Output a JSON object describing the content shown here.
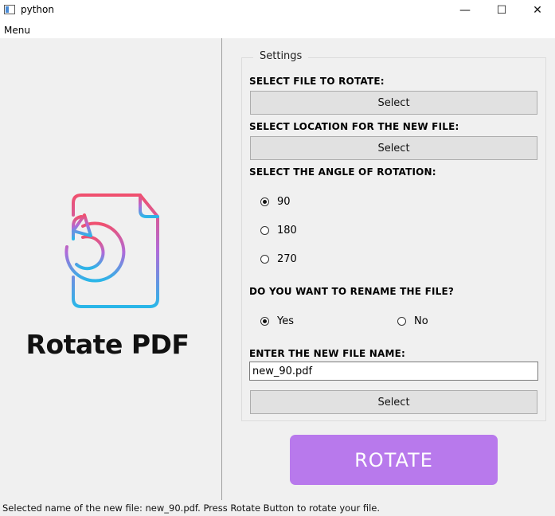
{
  "window": {
    "title": "python",
    "minimize_glyph": "—",
    "maximize_glyph": "☐",
    "close_glyph": "✕"
  },
  "menubar": {
    "menu_label": "Menu"
  },
  "logo": {
    "title": "Rotate PDF",
    "gradient_colors": [
      "#f0506e",
      "#b06ad9",
      "#2ab6e8"
    ]
  },
  "settings": {
    "group_title": "Settings",
    "select_file_label": "SELECT FILE TO ROTATE:",
    "select_file_button": "Select",
    "select_location_label": "SELECT LOCATION FOR THE NEW FILE:",
    "select_location_button": "Select",
    "angle_label": "SELECT THE ANGLE OF ROTATION:",
    "angles": [
      {
        "label": "90",
        "checked": true
      },
      {
        "label": "180",
        "checked": false
      },
      {
        "label": "270",
        "checked": false
      }
    ],
    "rename_label": "DO YOU WANT TO RENAME THE FILE?",
    "rename_options": [
      {
        "label": "Yes",
        "checked": true
      },
      {
        "label": "No",
        "checked": false
      }
    ],
    "new_name_label": "ENTER THE NEW FILE NAME:",
    "new_name_value": "new_90.pdf",
    "new_name_button": "Select"
  },
  "rotate_button": {
    "label": "ROTATE",
    "color": "#b879ec"
  },
  "status": {
    "text": "Selected name of the new file: new_90.pdf. Press Rotate Button to rotate your file."
  }
}
